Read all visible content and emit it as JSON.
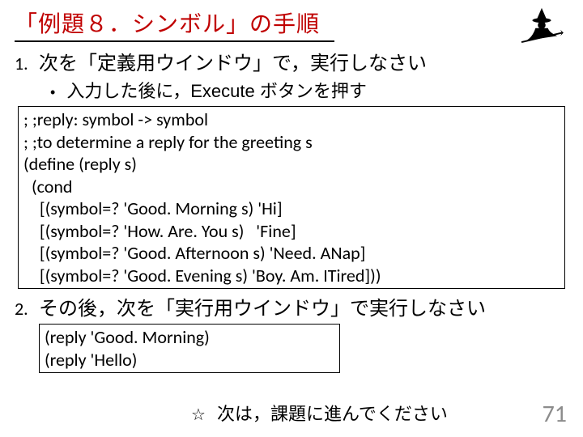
{
  "title": "「例題８．シンボル」の手順",
  "step1": {
    "num": "1.",
    "text": "次を「定義用ウインドウ」で，実行しなさい",
    "bullet": "入力した後に，Execute ボタンを押す"
  },
  "code1": {
    "l1": "; ;reply: symbol -> symbol",
    "l2": "; ;to determine a reply for the greeting s",
    "l3": "(define (reply s)",
    "l4": "  (cond",
    "l5": "    [(symbol=? 'Good. Morning s) 'Hi]",
    "l6": "    [(symbol=? 'How. Are. You s)   'Fine]",
    "l7": "    [(symbol=? 'Good. Afternoon s) 'Need. ANap]",
    "l8": "    [(symbol=? 'Good. Evening s) 'Boy. Am. ITired]))"
  },
  "step2": {
    "num": "2.",
    "text": "その後，次を「実行用ウインドウ」で実行しなさい"
  },
  "code2": {
    "l1": "(reply 'Good. Morning)",
    "l2": "(reply 'Hello)"
  },
  "note": "次は，課題に進んでください",
  "star": "☆",
  "page": "71"
}
